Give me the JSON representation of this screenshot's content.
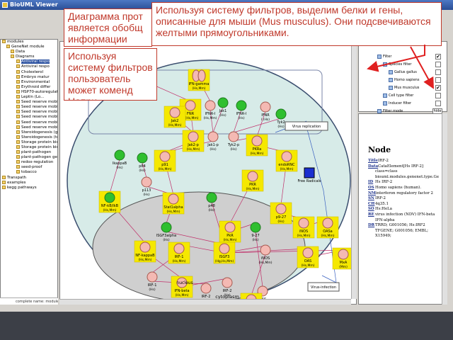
{
  "window": {
    "title": "BioUML Viewer"
  },
  "tree": {
    "rows": [
      {
        "label": "modules",
        "selected": false
      },
      {
        "label": "GeneNet module",
        "selected": false
      },
      {
        "label": "Data",
        "selected": false
      },
      {
        "label": "Diagrams",
        "selected": false
      },
      {
        "label": "Antiviral respo",
        "selected": true
      },
      {
        "label": "Antiviral respo",
        "selected": false
      },
      {
        "label": "Cholesterol",
        "selected": false
      },
      {
        "label": "Embryo matur",
        "selected": false
      },
      {
        "label": "Environmental",
        "selected": false
      },
      {
        "label": "Erythroid differ",
        "selected": false
      },
      {
        "label": "HSP70-autoregulation",
        "selected": false
      },
      {
        "label": "Leptin (Lo...",
        "selected": false
      },
      {
        "label": "Seed reserve mobilisation: c",
        "selected": false
      },
      {
        "label": "Seed reserve mobilisation: sp",
        "selected": false
      },
      {
        "label": "Seed reserve mobilisation: ab",
        "selected": false
      },
      {
        "label": "Seed reserve mobilisation: ga",
        "selected": false
      },
      {
        "label": "Seed reserve mobilisation: th",
        "selected": false
      },
      {
        "label": "Seed reserve mobilisation: ot",
        "selected": false
      },
      {
        "label": "Steroidogenesis (glucocortic",
        "selected": false
      },
      {
        "label": "Steroidogenesis (testostero",
        "selected": false
      },
      {
        "label": "Storage protein biosynthesis",
        "selected": false
      },
      {
        "label": "Storage protein biosynthesi",
        "selected": false
      },
      {
        "label": "plant-pathogen",
        "selected": false
      },
      {
        "label": "plant-pathogen general",
        "selected": false
      },
      {
        "label": "redox-regulation",
        "selected": false
      },
      {
        "label": "seed-proof",
        "selected": false
      },
      {
        "label": "tobacco",
        "selected": false
      },
      {
        "label": "Transpath",
        "selected": false
      },
      {
        "label": "examples",
        "selected": false
      },
      {
        "label": "kegg pathways",
        "selected": false
      }
    ],
    "complete_name": "complete name: modules/GeneNet"
  },
  "filter": {
    "rows": [
      {
        "label": "Filter",
        "checked": true
      },
      {
        "label": "Species filter",
        "checked": false
      },
      {
        "label": "Gallus gallus",
        "checked": false
      },
      {
        "label": "Homo sapiens",
        "checked": false
      },
      {
        "label": "Mus musculus",
        "checked": true
      },
      {
        "label": "Cell type filter",
        "checked": false
      },
      {
        "label": "Inducer filter",
        "checked": false
      },
      {
        "label": "Filter mode",
        "checked": false
      }
    ],
    "filter_mode_value": "hide"
  },
  "node_info": {
    "heading": "Node",
    "rows": [
      {
        "key": "Title",
        "value": "IRF-2"
      },
      {
        "key": "Data",
        "value": "CataElement[Hs IRF-2]"
      },
      {
        "key": "",
        "value": "class=class"
      },
      {
        "key": "",
        "value": "biouml.modules.genenet.type.Ge"
      },
      {
        "key": "ID",
        "value": "Hs IRF-2"
      },
      {
        "key": "OS",
        "value": "Homo sapiens (human)."
      },
      {
        "key": "NM",
        "value": "interferon regulatory factor 2"
      },
      {
        "key": "SN",
        "value": "IRF-2"
      },
      {
        "key": "CH",
        "value": "4q35.1"
      },
      {
        "key": "SO",
        "value": "Hs:HeLa"
      },
      {
        "key": "RE",
        "value": "virus infection (NDV) IFN-beta"
      },
      {
        "key": "",
        "value": "IFN-alpha"
      },
      {
        "key": "DR",
        "value": "TRRD; G001056; Hs:IRF2"
      },
      {
        "key": "",
        "value": "TFGENE; G001056; EMBL;"
      },
      {
        "key": "",
        "value": "X15949;"
      }
    ]
  },
  "diagram": {
    "labels": {
      "virus_replication": "Virus replication",
      "free_radicals": "Free Radicals",
      "virus_infection": "Virus-infection",
      "nucleus": "nucleus",
      "cytoplasm": "cytoplasm"
    },
    "nodes": [
      {
        "label": "IFN-beta (Hs,Mm)"
      },
      {
        "label": "IFN-gamma (Hs,Mm)"
      },
      {
        "label": "FNR II (Hs,Mm)"
      },
      {
        "label": "IFNR-I (Hs,Mm)"
      },
      {
        "label": "Jak1 (Hs)"
      },
      {
        "label": "IFNR-I (Hs)"
      },
      {
        "label": "IFNR I (Hs)"
      },
      {
        "label": "Jak2 (Hs,Mm)"
      },
      {
        "label": "Tyk2 (Hs)"
      },
      {
        "label": "Jak2-p (Hs,Mm)"
      },
      {
        "label": "Jak1-p (Hs)"
      },
      {
        "label": "Tyk2-p (Hs)"
      },
      {
        "label": "PKRa (Hs,Mm)"
      },
      {
        "label": "IkappaB (Hs)"
      },
      {
        "label": "p84 (Hs)"
      },
      {
        "label": "p91 (Hs,Mm)"
      },
      {
        "label": "endoRNC (Hs,Mm)"
      },
      {
        "label": "p113 (Hs)"
      },
      {
        "label": "NF-kB/IkB (Hs,Mm)"
      },
      {
        "label": "PKR (Hs,Mm)"
      },
      {
        "label": "Stat1alpha (Hs,Mm)"
      },
      {
        "label": "p48 (Hs)"
      },
      {
        "label": "p9-27 (Hs)"
      },
      {
        "label": "iNOS (Hs,Mm)"
      },
      {
        "label": "OASa (Hs,Mm)"
      },
      {
        "label": "ISGF3alpha (Hs)"
      },
      {
        "label": "PkR (Hs,Mm)"
      },
      {
        "label": "9-27 (Hs)"
      },
      {
        "label": "NF-kappaB (Hs,Mm)"
      },
      {
        "label": "IRF-1 (Hs,Mm)"
      },
      {
        "label": "ISGF3 (Hg,Hs,Mm)"
      },
      {
        "label": "iNOS (Hs,Mm)"
      },
      {
        "label": "OAS (Hs,Mm)"
      },
      {
        "label": "MxA (Mm)"
      },
      {
        "label": "IRF-1 (Hs)"
      },
      {
        "label": "IFN-beta (Hs,Mm)"
      },
      {
        "label": "IRF-2 (Hs)"
      },
      {
        "label": "IRF-2 (Hs)"
      },
      {
        "label": "OAS (Hs)"
      },
      {
        "label": "Mx (Hg)"
      }
    ]
  },
  "callouts": {
    "c1": "Диаграмма прот является обобщ информации (Gall",
    "c2": "Используя систему фильтров пользователь может коменд Напри",
    "c3": "Используя систему фильтров, выделим белки и гены, описанные для мыши (Mus musculus). Они подсвечиваются желтыми прямоугольниками."
  },
  "colors": {
    "callout_border": "#c0392b",
    "callout_text": "#c0392b",
    "protein_fill": "#f4b9b3",
    "gene_fill": "#2fbf2f",
    "highlight": "#f5e800",
    "cell_bg": "#d7ebe8",
    "nucleus_bg": "#cfcfcf"
  }
}
